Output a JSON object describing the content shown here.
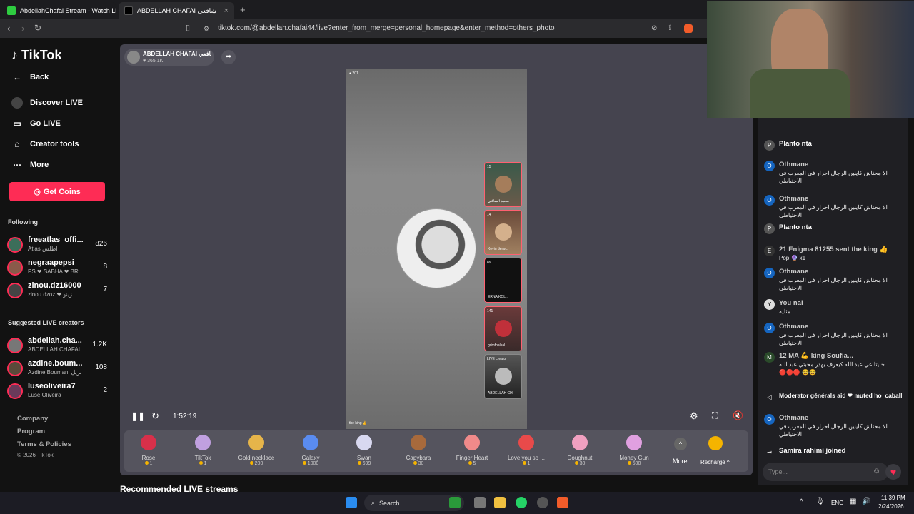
{
  "browser": {
    "tabs": [
      {
        "title": "AbdellahChafai Stream - Watch Live :"
      },
      {
        "title": "ABDELLAH CHAFAI عبدالله شافعي"
      }
    ],
    "new_tab_label": "+",
    "url": "tiktok.com/@abdellah.chafai44/live?enter_from_merge=personal_homepage&enter_method=others_photo"
  },
  "sidebar": {
    "logo": "TikTok",
    "back": "Back",
    "nav": [
      "Discover LIVE",
      "Go LIVE",
      "Creator tools",
      "More"
    ],
    "coins": "Get Coins",
    "following_title": "Following",
    "following": [
      {
        "name": "freeatlas_offi...",
        "sub": "Atlas أطلس",
        "count": "826"
      },
      {
        "name": "negraapepsi",
        "sub": "PS ❤ SABHA ❤ BR",
        "count": "8"
      },
      {
        "name": "zinou.dz16000",
        "sub": "zinou.dzoz ❤ زينو",
        "count": "7"
      }
    ],
    "suggested_title": "Suggested LIVE creators",
    "suggested": [
      {
        "name": "abdellah.cha...",
        "sub": "ABDELLAH CHAFAI...",
        "count": "1.2K"
      },
      {
        "name": "azdine.boum...",
        "sub": "Azdine Boumani نزيل",
        "count": "108"
      },
      {
        "name": "luseoliveira7",
        "sub": "Luse Oliveira",
        "count": "2"
      }
    ],
    "footer": [
      "Company",
      "Program",
      "Terms & Policies",
      "© 2026 TikTok"
    ]
  },
  "live": {
    "host_name": "ABDELLAH CHAFAI عبدالله شافعي",
    "likes": "365.1K",
    "viewer_badge": "201",
    "guests": [
      {
        "name": "محمد الساكني",
        "count": "15"
      },
      {
        "name": "Kevin derw...",
        "count": "14"
      },
      {
        "name": "ERNA KOL...",
        "count": "89"
      },
      {
        "name": "gdmfnalsal...",
        "count": "141"
      },
      {
        "name": "ABDELLAH CH",
        "count": "LIVE creator"
      }
    ],
    "bottom_label": "the king 👍",
    "elapsed": "1:52:19",
    "gifts": [
      {
        "name": "Rose",
        "price": "1",
        "color": "#d8304a"
      },
      {
        "name": "TikTok",
        "price": "1",
        "color": "#c0a0e0"
      },
      {
        "name": "Gold necklace",
        "price": "200",
        "color": "#e6b54a"
      },
      {
        "name": "Galaxy",
        "price": "1000",
        "color": "#5a8cf0"
      },
      {
        "name": "Swan",
        "price": "699",
        "color": "#d8d8f0"
      },
      {
        "name": "Capybara",
        "price": "30",
        "color": "#a86a3c"
      },
      {
        "name": "Finger Heart",
        "price": "5",
        "color": "#f08a8a"
      },
      {
        "name": "Love you so ...",
        "price": "1",
        "color": "#e84a4a"
      },
      {
        "name": "Doughnut",
        "price": "30",
        "color": "#f0a0c0"
      },
      {
        "name": "Money Gun",
        "price": "500",
        "color": "#e0a0e0"
      }
    ],
    "more": "More",
    "recharge": "Recharge ^",
    "recommended": "Recommended LIVE streams"
  },
  "chat": {
    "messages": [
      {
        "user": "Planto nta",
        "text": "",
        "avatar": "P"
      },
      {
        "user": "Othmane",
        "text": "الا محتاش كاينين الرجال احرار في المغرب في الاحتياطي",
        "avatar": "O"
      },
      {
        "user": "Othmane",
        "text": "الا محتاش كاينين الرجال احرار في المغرب في الاحتياطي",
        "avatar": "O"
      },
      {
        "user": "Planto nta",
        "text": "",
        "avatar": "P"
      },
      {
        "user": "21 Enigma 81255 sent the king 👍",
        "text": "Pop 🔮 x1",
        "avatar": "E"
      },
      {
        "user": "Othmane",
        "text": "الا محتاش كاينين الرجال احرار في المغرب في الاحتياطي",
        "avatar": "O"
      },
      {
        "user": "You nai",
        "text": "مثليه",
        "avatar": "Y"
      },
      {
        "user": "Othmane",
        "text": "الا محتاش كاينين الرجال احرار في المغرب في الاحتياطي",
        "avatar": "O"
      },
      {
        "user": "12 MA 💪 king Soufia...",
        "text": "خليتا عي عبد الله كيعرف يهدر محبتي عبد الله 🔴🔴🔴 😂😂",
        "avatar": "M"
      },
      {
        "user": "Moderator générals aid ❤ muted ho_caball",
        "text": "",
        "avatar": "◁"
      },
      {
        "user": "Othmane",
        "text": "الا محتاش كاينين الرجال احرار في المغرب في الاحتياطي",
        "avatar": "O"
      },
      {
        "user": "Samira rahimi joined",
        "text": "",
        "avatar": "⇥"
      }
    ],
    "input_placeholder": "Type..."
  },
  "taskbar": {
    "search": "Search",
    "lang": "ENG",
    "time": "11:39 PM",
    "date": "2/24/2026"
  }
}
